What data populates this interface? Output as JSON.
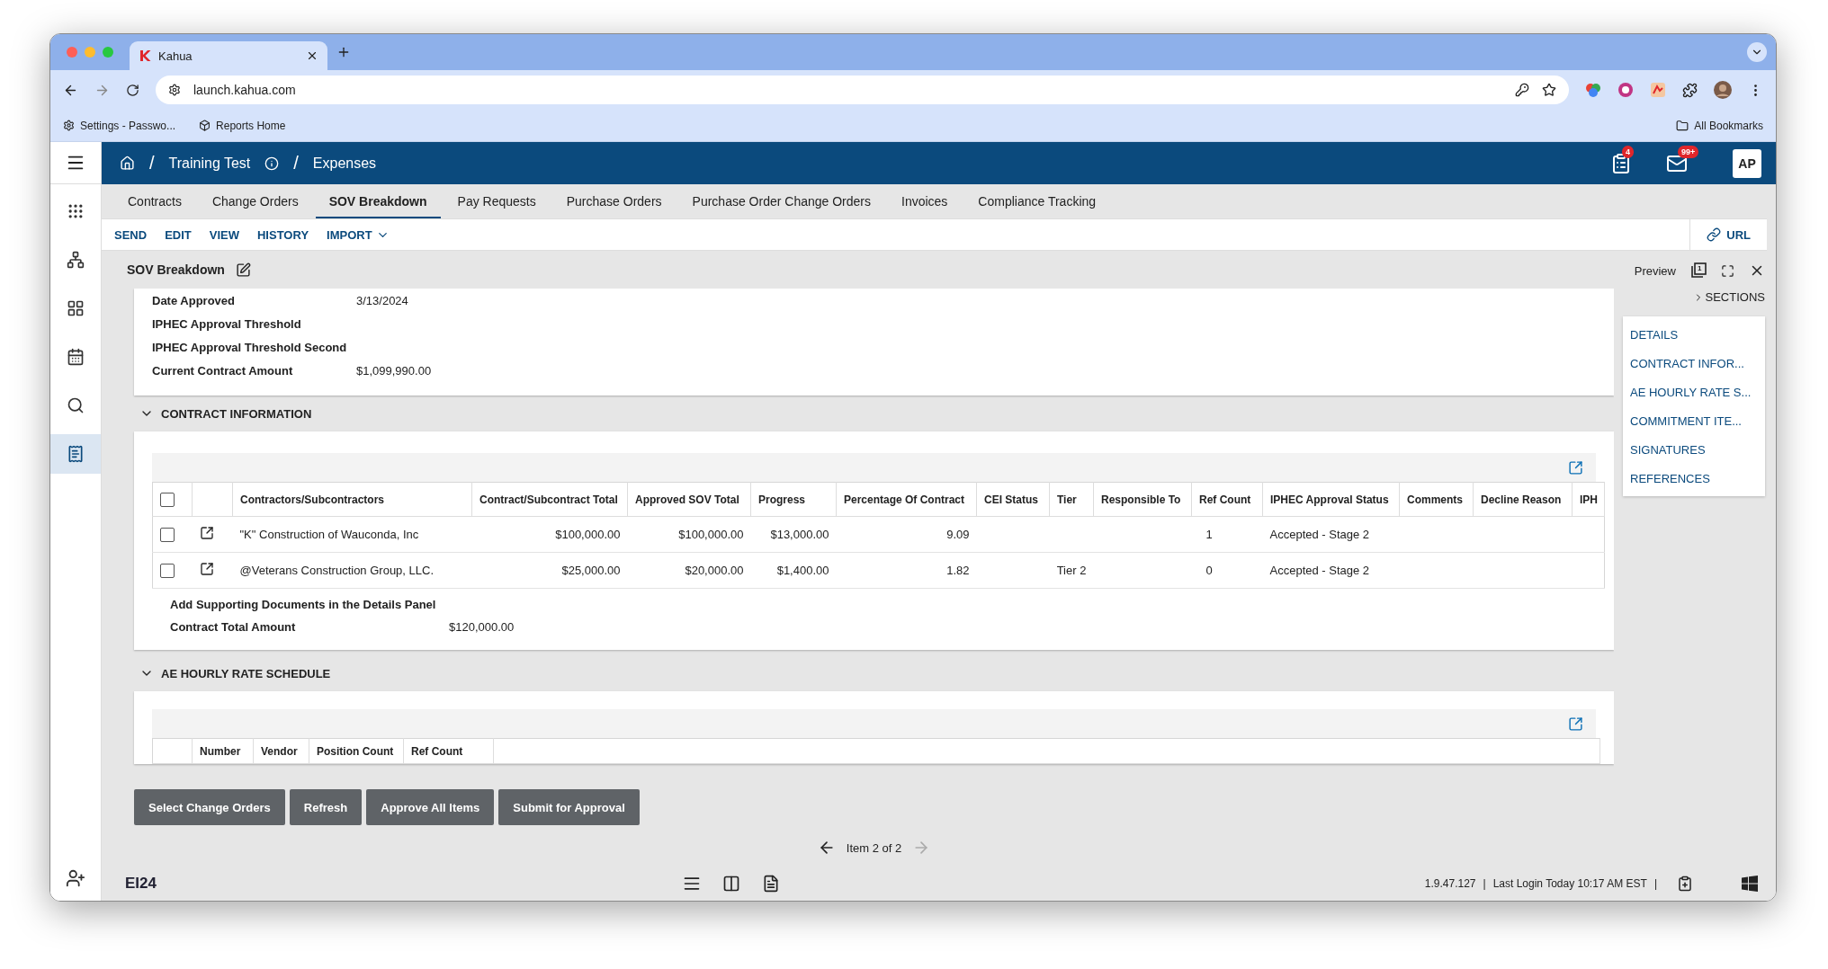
{
  "browser": {
    "tab_title": "Kahua",
    "url": "launch.kahua.com",
    "bookmarks": [
      {
        "kind": "gear",
        "label": "Settings - Passwo..."
      },
      {
        "kind": "cube",
        "label": "Reports Home"
      }
    ],
    "all_bookmarks": "All Bookmarks"
  },
  "header": {
    "separator": "/",
    "breadcrumb": [
      "Training Test",
      "Expenses"
    ],
    "tasks_badge": "4",
    "mail_badge": "99+",
    "avatar": "AP"
  },
  "tabs": [
    {
      "label": "Contracts",
      "selected": false
    },
    {
      "label": "Change Orders",
      "selected": false
    },
    {
      "label": "SOV Breakdown",
      "selected": true
    },
    {
      "label": "Pay Requests",
      "selected": false
    },
    {
      "label": "Purchase Orders",
      "selected": false
    },
    {
      "label": "Purchase Order Change Orders",
      "selected": false
    },
    {
      "label": "Invoices",
      "selected": false
    },
    {
      "label": "Compliance Tracking",
      "selected": false
    }
  ],
  "actions": [
    {
      "label": "SEND",
      "kind": "plain"
    },
    {
      "label": "EDIT",
      "kind": "plain"
    },
    {
      "label": "VIEW",
      "kind": "plain"
    },
    {
      "label": "HISTORY",
      "kind": "plain"
    },
    {
      "label": "IMPORT",
      "kind": "menu"
    }
  ],
  "url_button": "URL",
  "page_title": "SOV Breakdown",
  "details": [
    {
      "label": "Date Approved",
      "value": "3/13/2024"
    },
    {
      "label": "IPHEC Approval Threshold"
    },
    {
      "label": "IPHEC Approval Threshold Second"
    },
    {
      "label": "Current Contract Amount",
      "value": "$1,099,990.00"
    }
  ],
  "contract_information": {
    "title": "CONTRACT INFORMATION",
    "expanded": true,
    "select_all_checked": false,
    "columns": [
      "Contractors/Subcontractors",
      "Contract/Subcontract Total",
      "Approved SOV Total",
      "Progress",
      "Percentage Of Contract",
      "CEI Status",
      "Tier",
      "Responsible To",
      "Ref Count",
      "IPHEC Approval Status",
      "Comments",
      "Decline Reason",
      "IPH"
    ],
    "rows": [
      {
        "checked": false,
        "cells": [
          "\"K\" Construction of Wauconda, Inc",
          "$100,000.00",
          "$100,000.00",
          "$13,000.00",
          "9.09",
          "",
          "",
          "",
          "1",
          "Accepted - Stage 2",
          "",
          "",
          ""
        ]
      },
      {
        "checked": false,
        "cells": [
          "@Veterans Construction Group, LLC.",
          "$25,000.00",
          "$20,000.00",
          "$1,400.00",
          "1.82",
          "",
          "Tier 2",
          "",
          "0",
          "Accepted - Stage 2",
          "",
          "",
          ""
        ]
      }
    ],
    "note": "Add Supporting Documents in the Details Panel",
    "total_label": "Contract Total Amount",
    "total_value": "$120,000.00"
  },
  "ae_hourly_rate_schedule": {
    "title": "AE HOURLY RATE SCHEDULE",
    "expanded": true,
    "columns": [
      "Number",
      "Vendor",
      "Position Count",
      "Ref Count"
    ]
  },
  "buttons": [
    "Select Change Orders",
    "Refresh",
    "Approve All Items",
    "Submit for Approval"
  ],
  "pagination": {
    "label": "Item 2 of 2",
    "prev_disabled": false,
    "next_disabled": true
  },
  "footer": {
    "logo": "EI24",
    "separator": "|",
    "version": "1.9.47.127",
    "last_login": "Last Login Today 10:17 AM EST"
  },
  "side_panel": {
    "title": "Preview",
    "preview_count": "1",
    "sections_label": "SECTIONS",
    "sections": [
      "DETAILS",
      "CONTRACT INFOR...",
      "AE HOURLY RATE S...",
      "COMMITMENT ITE...",
      "SIGNATURES",
      "REFERENCES"
    ]
  }
}
